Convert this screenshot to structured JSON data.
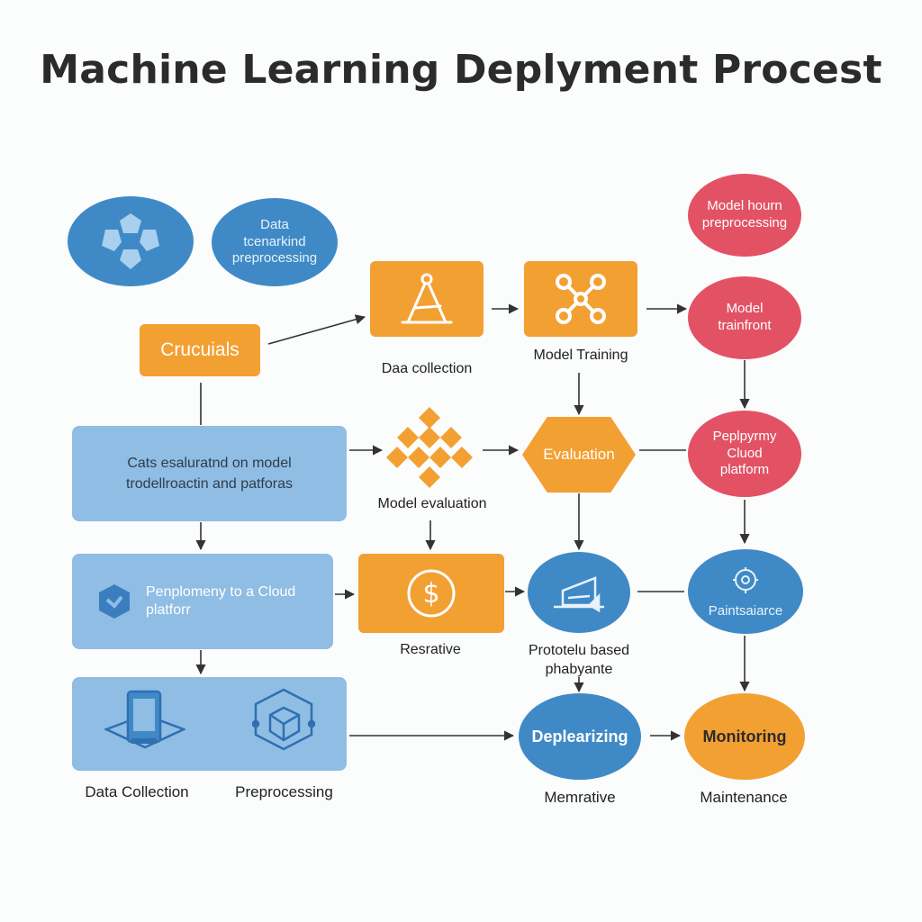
{
  "title": "Machine Learning Deplyment Procest",
  "nodes": {
    "data_preprocessing": "Data\ntcenarkind\npreprocessing",
    "model_hourn": "Model hourn\npreprocessing",
    "crucuials": "Crucuials",
    "model_trainfront": "Model\ntrainfront",
    "data_collection_caption": "Daa collection",
    "model_training_caption": "Model Training",
    "cats_panel": "Cats esaluratnd on model\ntrodellroactin and patforas",
    "model_evaluation_caption": "Model evaluation",
    "evaluation": "Evaluation",
    "peplpyrmy": "Peplpyrmy\nCluod\nplatform",
    "penplomeny": "Penplomeny to a Cloud\nplatforr",
    "resrative_caption": "Resrative",
    "prototelu_caption": "Prototelu based\nphabyante",
    "paintsaiarce": "Paintsaiarce",
    "data_collection_bottom": "Data Collection",
    "preprocessing_bottom": "Preprocessing",
    "deplearizing": "Deplearizing",
    "memrative_caption": "Memrative",
    "monitoring": "Monitoring",
    "maintenance_caption": "Maintenance"
  },
  "colors": {
    "blue": "#3f8ac6",
    "red": "#e25264",
    "orange": "#f3a033",
    "light_blue": "#8fbde4",
    "arrow": "#333333"
  },
  "icons": {
    "cluster": "gear-cluster-icon",
    "a_frame": "a-frame-icon",
    "network": "network-icon",
    "diamonds": "diamond-grid-icon",
    "shield": "shield-icon",
    "dollar": "dollar-icon",
    "chart_screen": "chart-screen-icon",
    "brain_gear": "brain-gear-icon",
    "tablet": "tablet-icon",
    "package": "package-icon"
  }
}
